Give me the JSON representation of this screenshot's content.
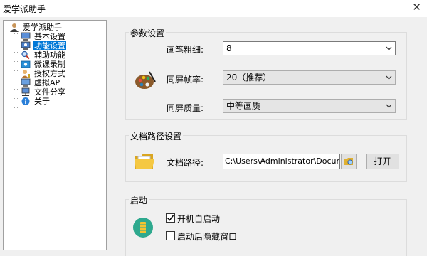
{
  "window": {
    "title": "爱学派助手",
    "close_glyph": "✕"
  },
  "tree": {
    "root": "爱学派助手",
    "items": [
      {
        "label": "基本设置",
        "icon": "monitor-icon"
      },
      {
        "label": "功能设置",
        "icon": "settings-monitor-icon",
        "selected": true
      },
      {
        "label": "辅助功能",
        "icon": "magnifier-icon"
      },
      {
        "label": "微课录制",
        "icon": "video-record-icon"
      },
      {
        "label": "授权方式",
        "icon": "user-key-icon"
      },
      {
        "label": "虚拟AP",
        "icon": "computer-icon"
      },
      {
        "label": "文件分享",
        "icon": "network-computer-icon"
      },
      {
        "label": "关于",
        "icon": "info-icon"
      }
    ]
  },
  "params": {
    "legend": "参数设置",
    "pen_label": "画笔粗细:",
    "pen_value": "8",
    "fps_label": "同屏帧率:",
    "fps_value": "20（推荐）",
    "quality_label": "同屏质量:",
    "quality_value": "中等画质"
  },
  "docpath": {
    "legend": "文档路径设置",
    "label": "文档路径:",
    "value": "C:\\Users\\Administrator\\Documents\\爱",
    "open_label": "打开"
  },
  "startup": {
    "legend": "启动",
    "autostart_label": "开机自启动",
    "autostart_checked": true,
    "hide_label": "启动后隐藏窗口",
    "hide_checked": false
  },
  "colors": {
    "selection": "#0078d7",
    "accent_green": "#2ea98e"
  }
}
